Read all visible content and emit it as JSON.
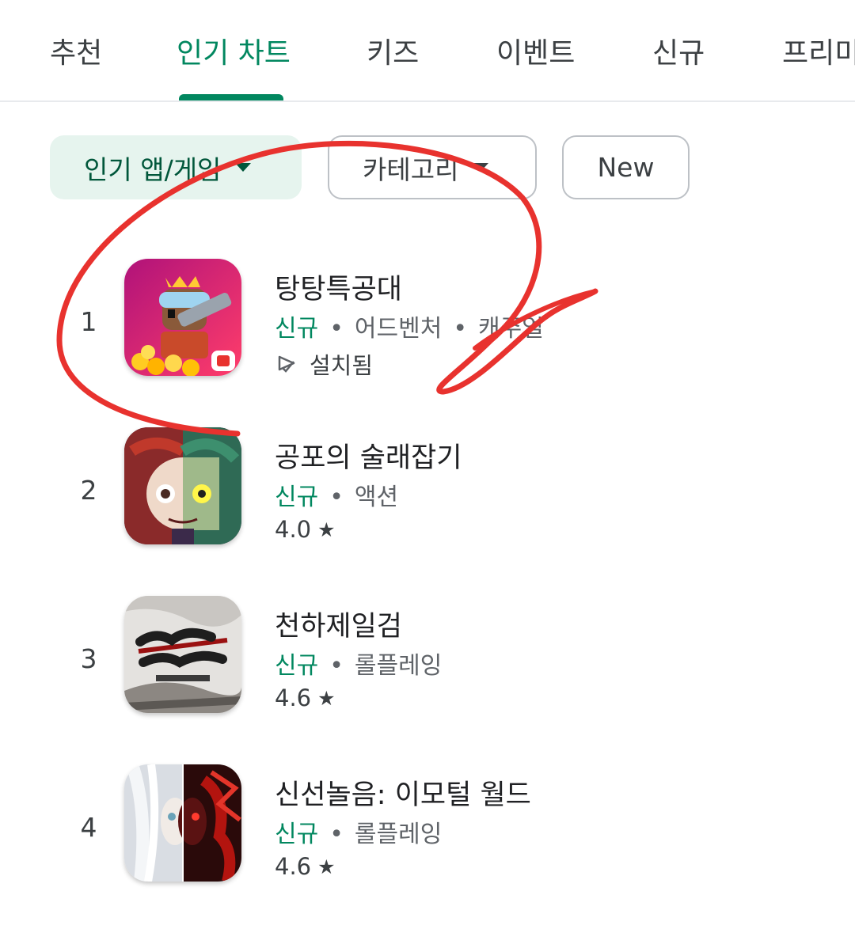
{
  "tabs": [
    "추천",
    "인기 차트",
    "키즈",
    "이벤트",
    "신규",
    "프리미"
  ],
  "chips": {
    "primary": "인기 앱/게임",
    "category": "카테고리",
    "new": "New"
  },
  "apps": [
    {
      "rank": "1",
      "title": "탕탕특공대",
      "tag": "신규",
      "genres": [
        "어드벤처",
        "캐주얼"
      ],
      "status": "설치됨"
    },
    {
      "rank": "2",
      "title": "공포의 술래잡기",
      "tag": "신규",
      "genres": [
        "액션"
      ],
      "rating": "4.0"
    },
    {
      "rank": "3",
      "title": "천하제일검",
      "tag": "신규",
      "genres": [
        "롤플레잉"
      ],
      "rating": "4.6"
    },
    {
      "rank": "4",
      "title": "신선놀음: 이모털 월드",
      "tag": "신규",
      "genres": [
        "롤플레잉"
      ],
      "rating": "4.6"
    }
  ],
  "star_glyph": "★",
  "dot_glyph": "•",
  "colors": {
    "accent": "#01875f",
    "chip_bg": "#e6f4ee",
    "annotation": "#e8322e"
  }
}
